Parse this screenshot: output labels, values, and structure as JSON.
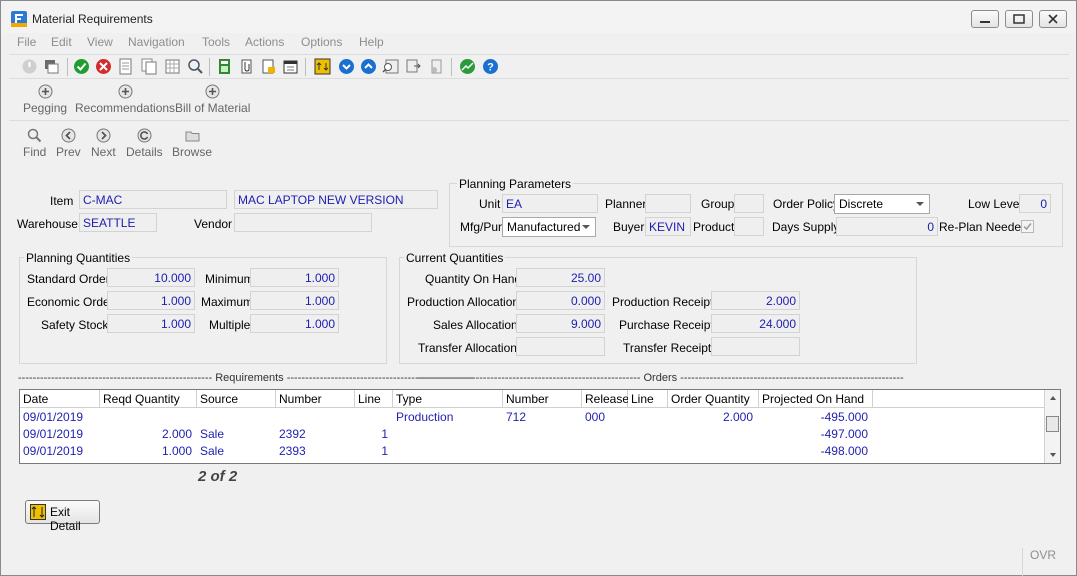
{
  "window": {
    "title": "Material Requirements",
    "menu": [
      "File",
      "Edit",
      "View",
      "Navigation",
      "Tools",
      "Actions",
      "Options",
      "Help"
    ]
  },
  "toolbar_top": {
    "icons": [
      "power-icon",
      "copy-window-icon",
      "check-icon",
      "cancel-icon",
      "doc-icon",
      "doc-copy-icon",
      "doc-grid-icon",
      "zoom-icon",
      "calc-icon",
      "attach-icon",
      "note-icon",
      "calendar-icon",
      "export-icon",
      "down-circle-icon",
      "up-circle-icon",
      "search-list-icon",
      "sync-icon",
      "info-icon",
      "chart-icon",
      "help-icon"
    ]
  },
  "toolbar_mid": [
    {
      "label": "Pegging"
    },
    {
      "label": "Recommendations"
    },
    {
      "label": "Bill of Material"
    }
  ],
  "toolbar_nav": [
    {
      "label": "Find"
    },
    {
      "label": "Prev"
    },
    {
      "label": "Next"
    },
    {
      "label": "Details"
    },
    {
      "label": "Browse"
    }
  ],
  "item": {
    "item_label": "Item",
    "item_value": "C-MAC",
    "description": "MAC LAPTOP  NEW VERSION",
    "warehouse_label": "Warehouse",
    "warehouse_value": "SEATTLE",
    "vendor_label": "Vendor",
    "vendor_value": ""
  },
  "planning_parameters": {
    "title": "Planning Parameters",
    "unit_label": "Unit",
    "unit_value": "EA",
    "planner_label": "Planner",
    "planner_value": "",
    "group_label": "Group",
    "group_value": "",
    "order_policy_label": "Order Policy",
    "order_policy_value": "Discrete",
    "low_level_label": "Low Level",
    "low_level_value": "0",
    "mfg_label": "Mfg/Pur",
    "mfg_value": "Manufactured",
    "buyer_label": "Buyer",
    "buyer_value": "KEVIN",
    "product_label": "Product",
    "product_value": "",
    "days_supply_label": "Days Supply",
    "days_supply_value": "0",
    "replan_label": "Re-Plan Needed"
  },
  "planning_quantities": {
    "title": "Planning Quantities",
    "standard_order_label": "Standard Order",
    "standard_order_value": "10.000",
    "minimum_label": "Minimum",
    "minimum_value": "1.000",
    "economic_order_label": "Economic Order",
    "economic_order_value": "1.000",
    "maximum_label": "Maximum",
    "maximum_value": "1.000",
    "safety_stock_label": "Safety Stock",
    "safety_stock_value": "1.000",
    "multiple_label": "Multiple",
    "multiple_value": "1.000"
  },
  "current_quantities": {
    "title": "Current Quantities",
    "qoh_label": "Quantity On Hand",
    "qoh_value": "25.00",
    "prod_alloc_label": "Production Allocations",
    "prod_alloc_value": "0.000",
    "prod_receipts_label": "Production Receipts",
    "prod_receipts_value": "2.000",
    "sales_alloc_label": "Sales Allocations",
    "sales_alloc_value": "9.000",
    "purchase_receipts_label": "Purchase Receipts",
    "purchase_receipts_value": "24.000",
    "transfer_alloc_label": "Transfer Allocations",
    "transfer_alloc_value": "",
    "transfer_receipts_label": "Transfer Receipts",
    "transfer_receipts_value": ""
  },
  "grid": {
    "requirements_banner": "----------------------------------------------------- Requirements ---------------------------------------------------",
    "orders_banner": "------------------------------------------------------------- Orders -------------------------------------------------------------",
    "headers": [
      "Date",
      "Reqd Quantity",
      "Source",
      "Number",
      "Line",
      "Type",
      "Number",
      "Release",
      "Line",
      "Order Quantity",
      "Projected On Hand"
    ],
    "rows": [
      [
        "09/01/2019",
        "",
        "",
        "",
        "",
        "Production",
        "712",
        "000",
        "",
        "2.000",
        "-495.000"
      ],
      [
        "09/01/2019",
        "2.000",
        "Sale",
        "2392",
        "1",
        "",
        "",
        "",
        "",
        "",
        "-497.000"
      ],
      [
        "09/01/2019",
        "1.000",
        "Sale",
        "2393",
        "1",
        "",
        "",
        "",
        "",
        "",
        "-498.000"
      ]
    ]
  },
  "counter": "2 of 2",
  "exit_button": "Exit Detail",
  "status": "OVR"
}
